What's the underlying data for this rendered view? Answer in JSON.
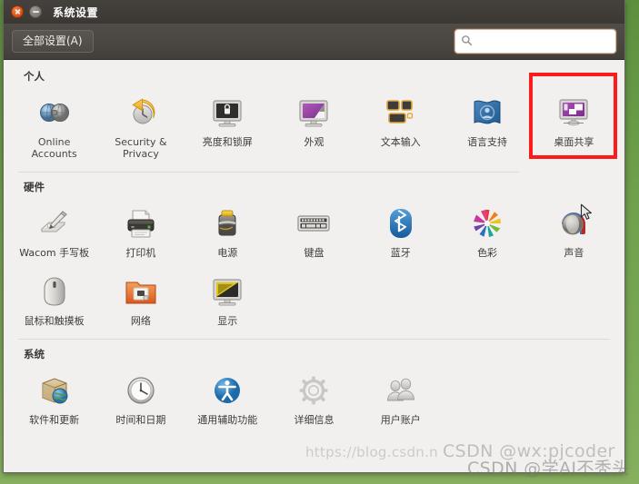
{
  "window": {
    "title": "系统设置",
    "close_label": "关闭",
    "minimize_label": "最小化"
  },
  "toolbar": {
    "all_settings_label": "全部设置(A)",
    "search_value": "",
    "search_placeholder": "",
    "search_icon": "search-icon"
  },
  "sections": [
    {
      "title": "个人",
      "items": [
        {
          "label": "Online Accounts",
          "icon": "online-accounts-icon",
          "latin": true
        },
        {
          "label": "Security & Privacy",
          "icon": "security-privacy-icon",
          "latin": true
        },
        {
          "label": "亮度和锁屏",
          "icon": "brightness-lock-icon",
          "latin": false
        },
        {
          "label": "外观",
          "icon": "appearance-icon",
          "latin": false
        },
        {
          "label": "文本输入",
          "icon": "text-entry-icon",
          "latin": false
        },
        {
          "label": "语言支持",
          "icon": "language-support-icon",
          "latin": false
        },
        {
          "label": "桌面共享",
          "icon": "desktop-sharing-icon",
          "latin": false,
          "highlighted": true
        }
      ]
    },
    {
      "title": "硬件",
      "items": [
        {
          "label": "Wacom 手写板",
          "icon": "wacom-tablet-icon",
          "latin": false
        },
        {
          "label": "打印机",
          "icon": "printer-icon",
          "latin": false
        },
        {
          "label": "电源",
          "icon": "power-icon",
          "latin": false
        },
        {
          "label": "键盘",
          "icon": "keyboard-icon",
          "latin": false
        },
        {
          "label": "蓝牙",
          "icon": "bluetooth-icon",
          "latin": false
        },
        {
          "label": "色彩",
          "icon": "color-icon",
          "latin": false
        },
        {
          "label": "声音",
          "icon": "sound-icon",
          "latin": false
        },
        {
          "label": "鼠标和触摸板",
          "icon": "mouse-touchpad-icon",
          "latin": false
        },
        {
          "label": "网络",
          "icon": "network-icon",
          "latin": false
        },
        {
          "label": "显示",
          "icon": "displays-icon",
          "latin": false
        }
      ]
    },
    {
      "title": "系统",
      "items": [
        {
          "label": "软件和更新",
          "icon": "software-updates-icon",
          "latin": false
        },
        {
          "label": "时间和日期",
          "icon": "time-date-icon",
          "latin": false
        },
        {
          "label": "通用辅助功能",
          "icon": "universal-access-icon",
          "latin": false
        },
        {
          "label": "详细信息",
          "icon": "details-icon",
          "latin": false
        },
        {
          "label": "用户账户",
          "icon": "user-accounts-icon",
          "latin": false
        }
      ]
    }
  ],
  "annotation": {
    "highlight_color": "#fc1a1a",
    "cursor_icon": "mouse-pointer-icon"
  },
  "watermarks": {
    "url": "https://blog.csdn.n",
    "csdn_handle": "CSDN @wx:pjcoder",
    "csdn_nickname": "CSDN @学AI不秃头"
  }
}
